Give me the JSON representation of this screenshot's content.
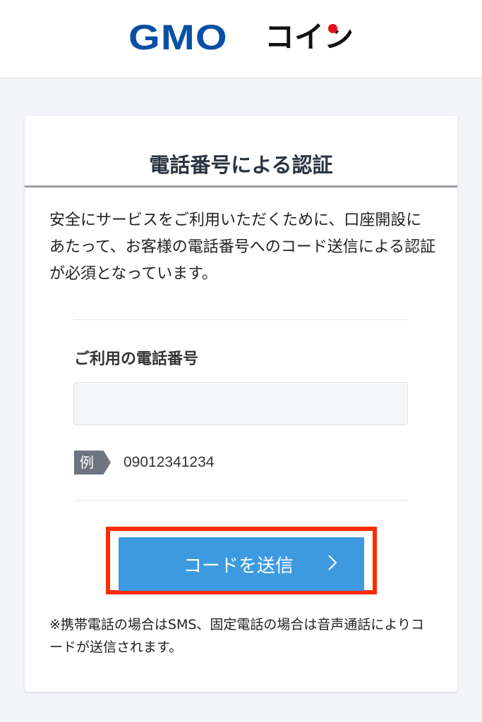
{
  "header": {
    "logo_gmo": "GMO",
    "logo_coin": "コイン"
  },
  "card": {
    "title": "電話番号による認証",
    "intro": "安全にサービスをご利用いただくために、口座開設にあたって、お客様の電話番号へのコード送信による認証が必須となっています。",
    "phone_label": "ご利用の電話番号",
    "phone_value": "",
    "phone_placeholder": "",
    "example_tag": "例",
    "example_value": "09012341234",
    "submit_label": "コードを送信",
    "note": "※携帯電話の場合はSMS、固定電話の場合は音声通話によりコードが送信されます。"
  },
  "colors": {
    "brand_blue": "#0a4fa3",
    "brand_red": "#e3101c",
    "button_blue": "#3d9ae0",
    "highlight_red": "#ff2a00"
  }
}
